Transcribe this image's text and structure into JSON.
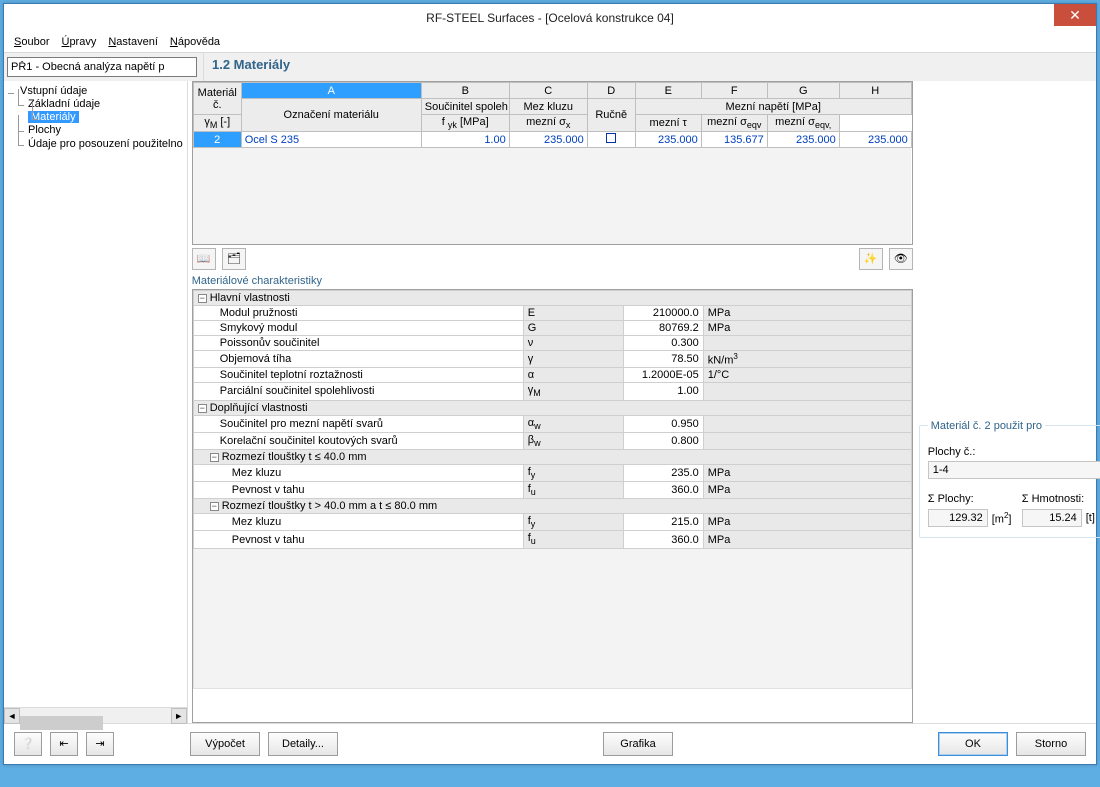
{
  "window": {
    "title": "RF-STEEL Surfaces - [Ocelová konstrukce 04]"
  },
  "menu": {
    "file": "Soubor",
    "edit": "Úpravy",
    "settings": "Nastavení",
    "help": "Nápověda"
  },
  "case_selector": "PŘ1 - Obecná analýza napětí p",
  "page_title": "1.2 Materiály",
  "tree": {
    "root": "Vstupní údaje",
    "items": [
      "Základní údaje",
      "Materiály",
      "Plochy",
      "Údaje pro posouzení použitelno"
    ],
    "selected_index": 1
  },
  "grid": {
    "rowhead_upper": "Materiál",
    "rowhead_lower": "č.",
    "colA_upper": "A",
    "colA_lower": "Označení materiálu",
    "colB_upper": "B",
    "colB_lower": "Součinitel spoleh",
    "colB_sub": "γM [-]",
    "colC_upper": "C",
    "colC_lower": "Mez kluzu",
    "colC_sub": "f yk [MPa]",
    "colD_upper": "D",
    "colD_lower": "Ručně",
    "groupE_H": "Mezní napětí [MPa]",
    "colE_upper": "E",
    "colE_lower": "mezní σx",
    "colF_upper": "F",
    "colF_lower": "mezní τ",
    "colG_upper": "G",
    "colG_lower": "mezní σeqv",
    "colH_upper": "H",
    "colH_lower": "mezní σeqv,",
    "row": {
      "num": "2",
      "name": "Ocel S 235",
      "gammaM": "1.00",
      "fyk": "235.000",
      "sigma_x": "235.000",
      "tau": "135.677",
      "sigma_eqv": "235.000",
      "sigma_eqv2": "235.000"
    }
  },
  "char_title": "Materiálové charakteristiky",
  "char": {
    "g1": "Hlavní vlastnosti",
    "r1": {
      "label": "Modul pružnosti",
      "sym": "E",
      "val": "210000.0",
      "unit": "MPa"
    },
    "r2": {
      "label": "Smykový modul",
      "sym": "G",
      "val": "80769.2",
      "unit": "MPa"
    },
    "r3": {
      "label": "Poissonův součinitel",
      "sym": "ν",
      "val": "0.300",
      "unit": ""
    },
    "r4": {
      "label": "Objemová tíha",
      "sym": "γ",
      "val": "78.50",
      "unit": "kN/m3"
    },
    "r5": {
      "label": "Součinitel teplotní roztažnosti",
      "sym": "α",
      "val": "1.2000E-05",
      "unit": "1/°C"
    },
    "r6": {
      "label": "Parciální součinitel spolehlivosti",
      "sym": "γM",
      "val": "1.00",
      "unit": ""
    },
    "g2": "Doplňující vlastnosti",
    "r7": {
      "label": "Součinitel pro mezní napětí svarů",
      "sym": "αw",
      "val": "0.950",
      "unit": ""
    },
    "r8": {
      "label": "Korelační součinitel koutových svarů",
      "sym": "βw",
      "val": "0.800",
      "unit": ""
    },
    "g3": "Rozmezí tlouštky t ≤ 40.0 mm",
    "r9": {
      "label": "Mez kluzu",
      "sym": "fy",
      "val": "235.0",
      "unit": "MPa"
    },
    "r10": {
      "label": "Pevnost v tahu",
      "sym": "fu",
      "val": "360.0",
      "unit": "MPa"
    },
    "g4": "Rozmezí tlouštky t > 40.0 mm a t ≤ 80.0 mm",
    "r11": {
      "label": "Mez kluzu",
      "sym": "fy",
      "val": "215.0",
      "unit": "MPa"
    },
    "r12": {
      "label": "Pevnost v tahu",
      "sym": "fu",
      "val": "360.0",
      "unit": "MPa"
    }
  },
  "side": {
    "used_title": "Materiál č. 2 použit pro",
    "surfaces_label": "Plochy č.:",
    "surfaces_value": "1-4",
    "sum_surf_label": "Σ Plochy:",
    "sum_surf_value": "129.32",
    "sum_surf_unit": "[m2]",
    "sum_mass_label": "Σ Hmotnosti:",
    "sum_mass_value": "15.24",
    "sum_mass_unit": "[t]"
  },
  "footer": {
    "calc": "Výpočet",
    "details": "Detaily...",
    "graphics": "Grafika",
    "ok": "OK",
    "cancel": "Storno"
  }
}
